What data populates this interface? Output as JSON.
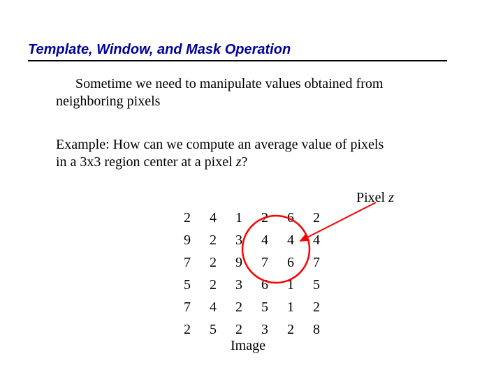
{
  "title": "Template, Window, and Mask Operation",
  "para1_a": "Sometime we need to manipulate values obtained from",
  "para1_b": "neighboring pixels",
  "para2_a": "Example: How can we compute an average value of pixels",
  "para2_b": "in a 3x3 region center at a pixel ",
  "para2_z": "z",
  "para2_q": "?",
  "pixelz_prefix": "Pixel ",
  "pixelz_z": "z",
  "image_caption": "Image",
  "grid": [
    [
      2,
      4,
      1,
      2,
      6,
      2
    ],
    [
      9,
      2,
      3,
      4,
      4,
      4
    ],
    [
      7,
      2,
      9,
      7,
      6,
      7
    ],
    [
      5,
      2,
      3,
      6,
      1,
      5
    ],
    [
      7,
      4,
      2,
      5,
      1,
      2
    ],
    [
      2,
      5,
      2,
      3,
      2,
      8
    ]
  ],
  "colors": {
    "title": "#000099",
    "ellipse_stroke": "#ff0000",
    "arrow_stroke": "#ff0000"
  }
}
